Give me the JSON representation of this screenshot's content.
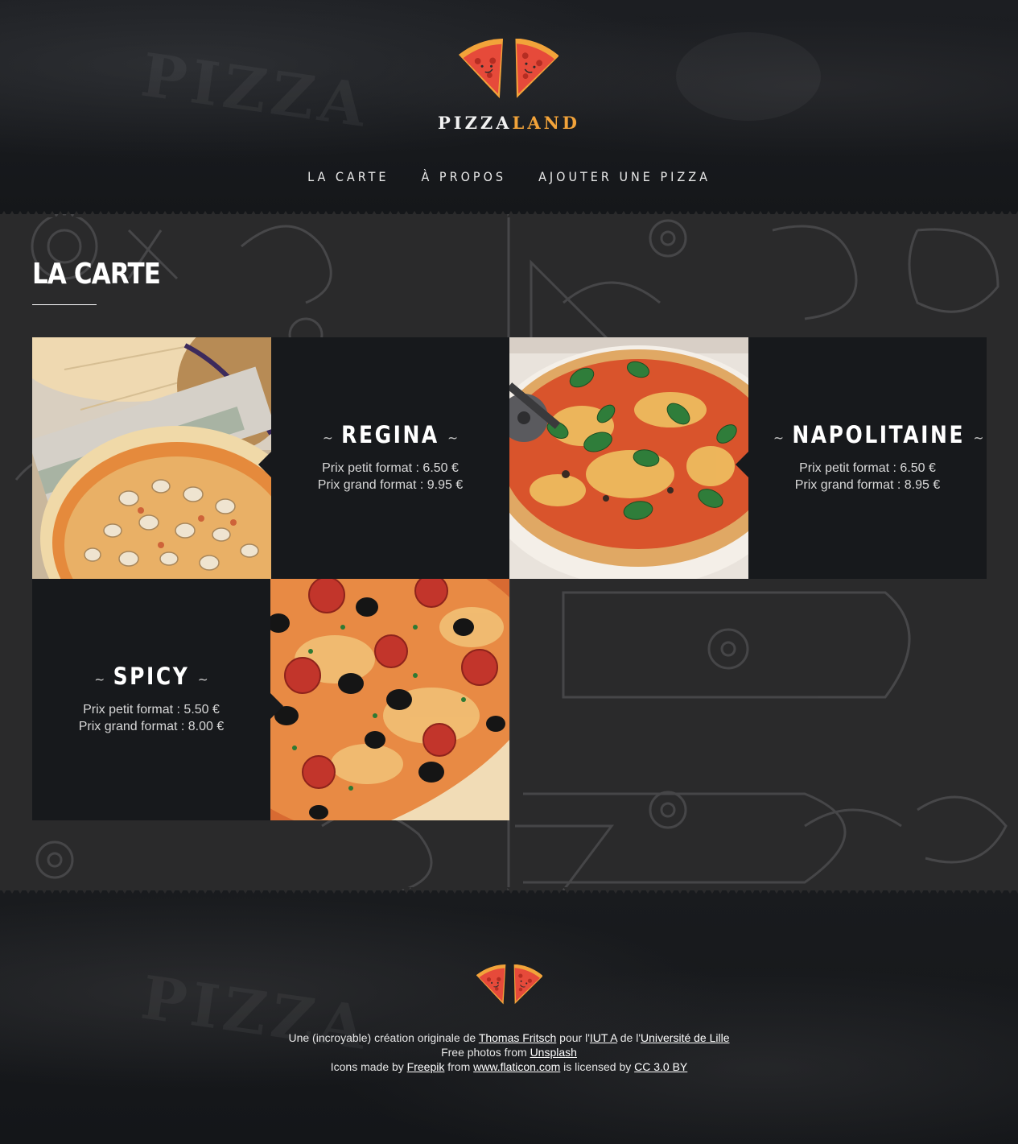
{
  "header": {
    "brand_part1": "PIZZA",
    "brand_part2": "LAND",
    "nav": [
      {
        "label": "LA CARTE"
      },
      {
        "label": "À PROPOS"
      },
      {
        "label": "AJOUTER UNE PIZZA"
      }
    ]
  },
  "main": {
    "title": "LA CARTE",
    "pizzas": [
      {
        "name": "REGINA",
        "price_small": "Prix petit format : 6.50 €",
        "price_large": "Prix grand format : 9.95 €"
      },
      {
        "name": "NAPOLITAINE",
        "price_small": "Prix petit format : 6.50 €",
        "price_large": "Prix grand format : 8.95 €"
      },
      {
        "name": "SPICY",
        "price_small": "Prix petit format : 5.50 €",
        "price_large": "Prix grand format : 8.00 €"
      }
    ],
    "tilde": "~"
  },
  "footer": {
    "line1_prefix": "Une (incroyable) création originale de ",
    "author_link": "Thomas Fritsch",
    "line1_mid1": " pour l'",
    "iut_link": "IUT A",
    "line1_mid2": " de l'",
    "univ_link": "Université de Lille",
    "line2_prefix": "Free photos from ",
    "unsplash_link": "Unsplash",
    "line3_prefix": "Icons made by ",
    "freepik_link": "Freepik",
    "line3_mid1": " from ",
    "flaticon_link": "www.flaticon.com",
    "line3_mid2": " is licensed by ",
    "license_link": "CC 3.0 BY"
  },
  "colors": {
    "accent": "#f2a33a",
    "dark_panel": "#17191c",
    "main_bg": "#2a2a2b"
  },
  "icons": [
    "pizza-slices-logo-icon"
  ]
}
